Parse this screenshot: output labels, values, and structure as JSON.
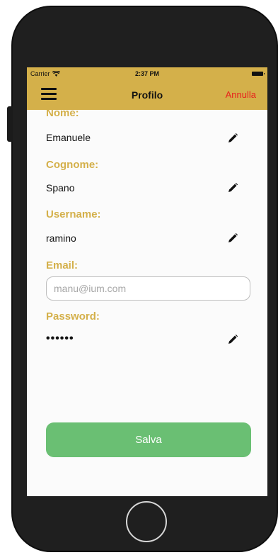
{
  "status_bar": {
    "carrier": "Carrier",
    "time": "2:37 PM"
  },
  "navbar": {
    "title": "Profilo",
    "cancel_label": "Annulla",
    "background_color": "#d4b04a",
    "cancel_color": "#e8201c"
  },
  "form": {
    "name": {
      "label": "Nome:",
      "value": "Emanuele"
    },
    "surname": {
      "label": "Cognome:",
      "value": "Spano"
    },
    "username": {
      "label": "Username:",
      "value": "ramino"
    },
    "email": {
      "label": "Email:",
      "placeholder": "manu@ium.com"
    },
    "password": {
      "label": "Password:",
      "value": "••••••"
    },
    "label_color": "#d4b04a"
  },
  "save_button": {
    "label": "Salva",
    "color": "#6abf73"
  },
  "icons": {
    "menu": "hamburger-menu-icon",
    "edit": "pencil-icon",
    "wifi": "wifi-icon",
    "battery": "battery-icon"
  }
}
